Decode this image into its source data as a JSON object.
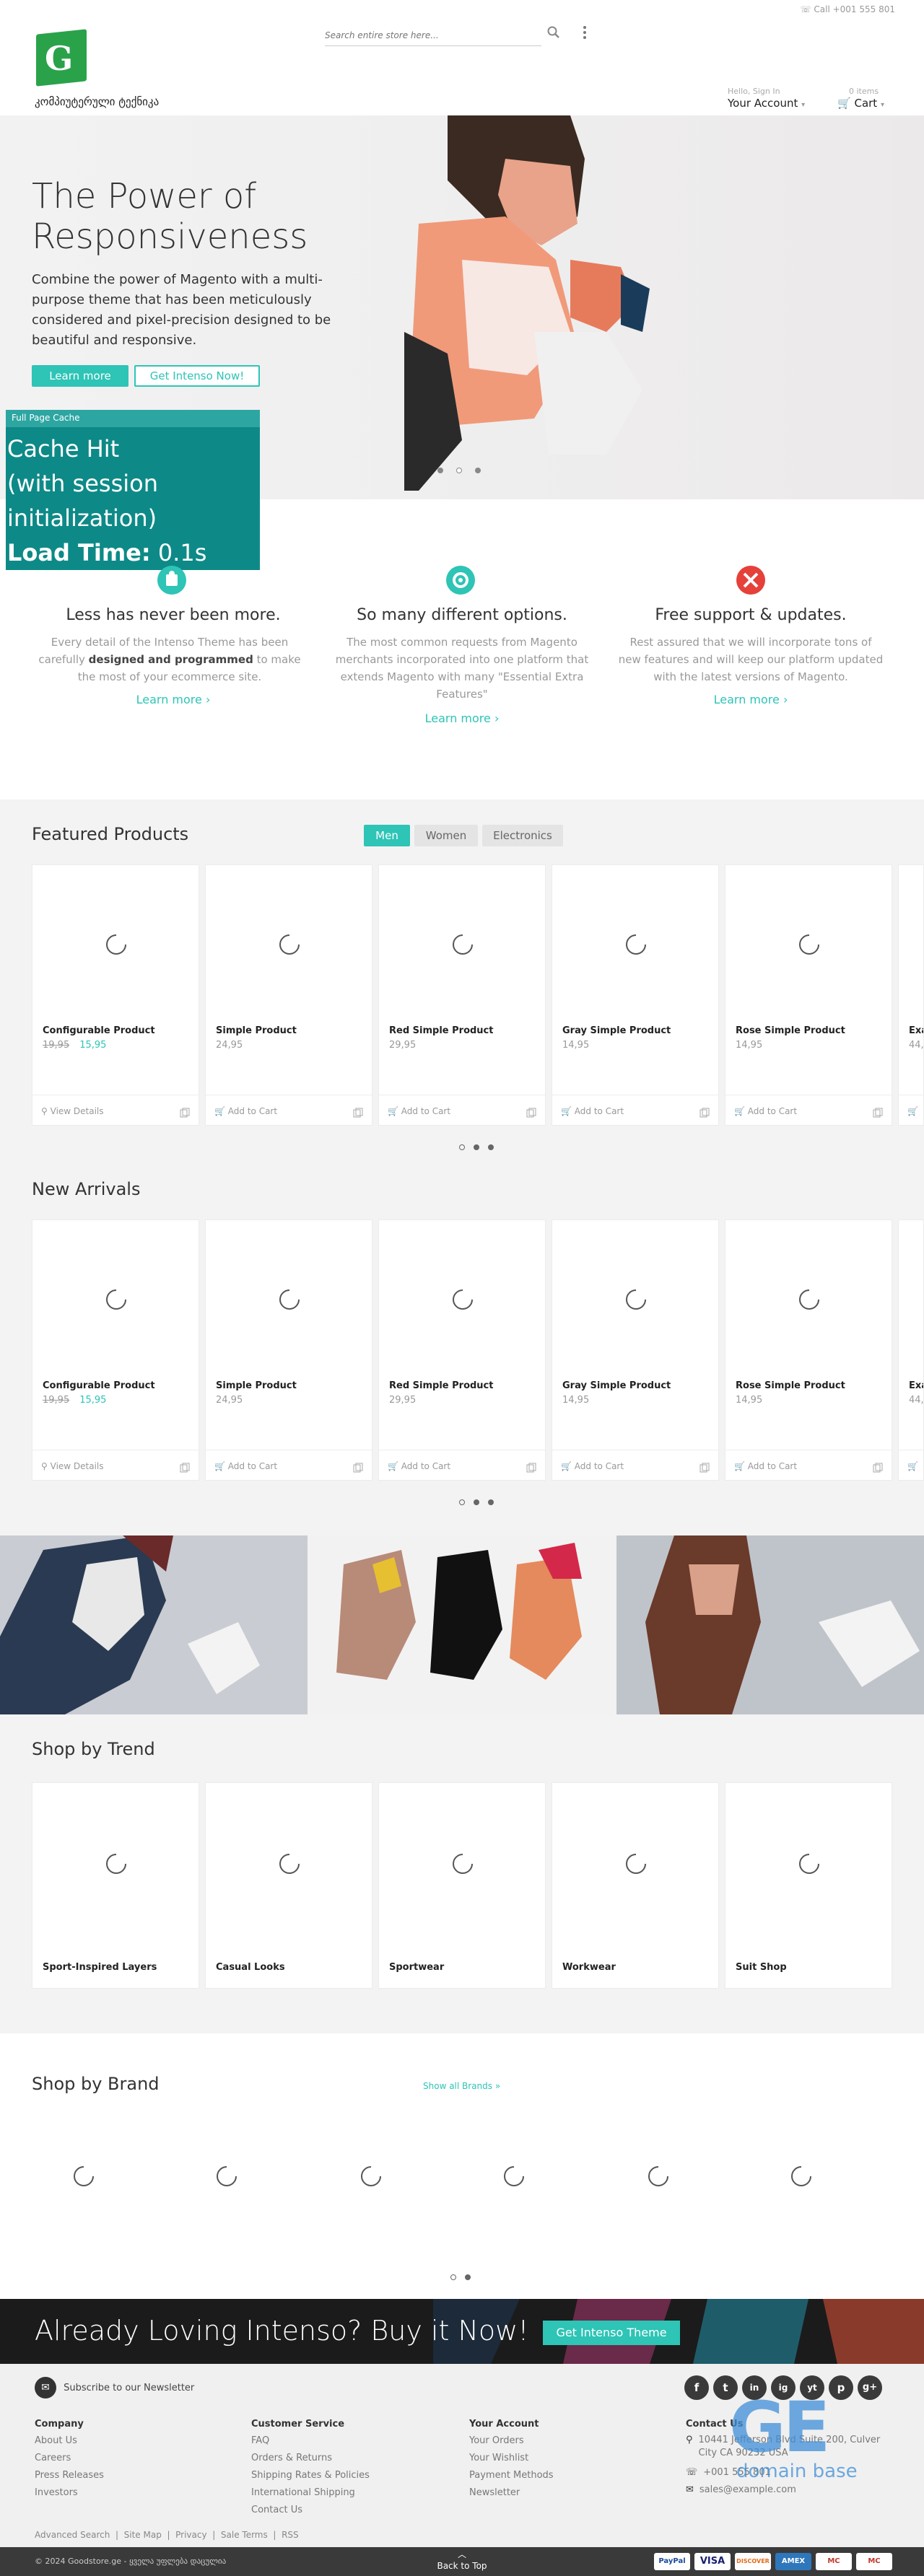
{
  "header": {
    "call": "Call +001 555 801",
    "logo_text": "კომპიუტერული ტექნიკა",
    "search_placeholder": "Search entire store here...",
    "account_hint": "Hello, Sign In",
    "account_label": "Your Account",
    "cart_hint": "0 items",
    "cart_label": "Cart"
  },
  "hero": {
    "title": "The Power of Responsiveness",
    "description": "Combine the power of Magento with a multi-purpose theme that has been meticulously considered and pixel-precision designed to be beautiful and responsive.",
    "btn_learn": "Learn more",
    "btn_get": "Get Intenso Now!",
    "slide_count": 3,
    "active_slide": 2
  },
  "cache": {
    "header": "Full Page Cache",
    "line1": "Cache Hit",
    "line2": "(with session",
    "line3": "initialization)",
    "load_label": "Load Time:",
    "load_value": "0.1s"
  },
  "features": [
    {
      "title": "Less has never been more.",
      "desc_a": "Every detail of the Intenso Theme has been carefully ",
      "desc_b": "designed and programmed",
      "desc_c": " to make the most of your ecommerce site.",
      "link": "Learn more ›",
      "icon": "puzzle-icon",
      "color": "#2ec4b6"
    },
    {
      "title": "So many different options.",
      "desc_a": "The most common requests from Magento merchants incorporated into one platform that extends Magento with many \"Essential Extra Features\"",
      "desc_b": "",
      "desc_c": "",
      "link": "Learn more ›",
      "icon": "gear-icon",
      "color": "#2ec4b6"
    },
    {
      "title": "Free support & updates.",
      "desc_a": "Rest assured that we will incorporate tons of new features and will keep our platform updated with the latest versions of Magento.",
      "desc_b": "",
      "desc_c": "",
      "link": "Learn more ›",
      "icon": "tools-icon",
      "color": "#e5403a"
    }
  ],
  "featured": {
    "title": "Featured Products",
    "tabs": [
      "Men",
      "Women",
      "Electronics"
    ],
    "active_tab": 0
  },
  "new_arrivals": {
    "title": "New Arrivals"
  },
  "products": [
    {
      "name": "Configurable Product",
      "old_price": "19,95",
      "price": "15,95",
      "action": "View Details"
    },
    {
      "name": "Simple Product",
      "old_price": "",
      "price": "24,95",
      "action": "Add to Cart"
    },
    {
      "name": "Red Simple Product",
      "old_price": "",
      "price": "29,95",
      "action": "Add to Cart"
    },
    {
      "name": "Gray Simple Product",
      "old_price": "",
      "price": "14,95",
      "action": "Add to Cart"
    },
    {
      "name": "Rose Simple Product",
      "old_price": "",
      "price": "14,95",
      "action": "Add to Cart"
    },
    {
      "name": "Exa",
      "old_price": "",
      "price": "44,",
      "action": ""
    }
  ],
  "trend": {
    "title": "Shop by Trend",
    "items": [
      "Sport-Inspired Layers",
      "Casual Looks",
      "Sportwear",
      "Workwear",
      "Suit Shop"
    ]
  },
  "brand": {
    "title": "Shop by Brand",
    "show_all": "Show all Brands »"
  },
  "cta": {
    "text": "Already Loving Intenso? Buy it Now!",
    "button": "Get Intenso Theme"
  },
  "footer": {
    "newsletter": "Subscribe to our Newsletter",
    "socials": [
      "f",
      "t",
      "in",
      "ig",
      "yt",
      "p",
      "g+"
    ],
    "cols": [
      {
        "head": "Company",
        "links": [
          "About Us",
          "Careers",
          "Press Releases",
          "Investors"
        ]
      },
      {
        "head": "Customer Service",
        "links": [
          "FAQ",
          "Orders & Returns",
          "Shipping Rates & Policies",
          "International Shipping",
          "Contact Us"
        ]
      },
      {
        "head": "Your Account",
        "links": [
          "Your Orders",
          "Your Wishlist",
          "Payment Methods",
          "Newsletter"
        ]
      }
    ],
    "contact_head": "Contact Us",
    "address": "10441 Jefferson Blvd Suite 200, Culver City CA 90232 USA",
    "phone": "+001 555 801",
    "email": "sales@example.com",
    "bottom_links": [
      "Advanced Search",
      "Site Map",
      "Privacy",
      "Sale Terms",
      "RSS"
    ],
    "watermark_big": "GE",
    "watermark_small": "domain base",
    "copyright": "© 2024 Goodstore.ge - ყველა უფლება დაცულია",
    "back_to_top": "Back to Top",
    "payments": [
      "PayPal",
      "VISA",
      "DISCOVER",
      "AMEX",
      "MC",
      "MC"
    ]
  }
}
